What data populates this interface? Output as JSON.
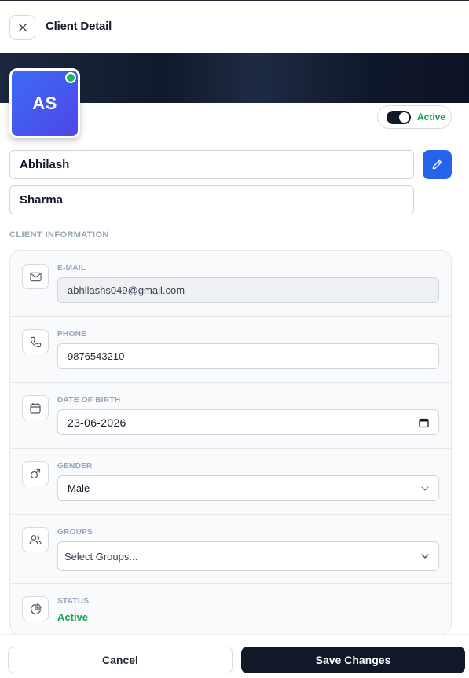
{
  "header": {
    "title": "Client Detail",
    "close_icon": "close-icon"
  },
  "profile": {
    "initials": "AS",
    "online": true,
    "status_toggle_label": "Active",
    "status_toggle_on": true,
    "first_name": "Abhilash",
    "last_name": "Sharma"
  },
  "section": {
    "title": "CLIENT INFORMATION"
  },
  "fields": {
    "email": {
      "label": "E-MAIL",
      "value": "abhilashs049@gmail.com",
      "icon": "mail-icon"
    },
    "phone": {
      "label": "PHONE",
      "value": "9876543210",
      "icon": "phone-icon"
    },
    "dob": {
      "label": "DATE OF BIRTH",
      "value": "23-06-2026",
      "icon": "calendar-icon"
    },
    "gender": {
      "label": "GENDER",
      "value": "Male",
      "icon": "gender-male-icon"
    },
    "groups": {
      "label": "GROUPS",
      "placeholder": "Select Groups...",
      "icon": "users-icon"
    },
    "status": {
      "label": "STATUS",
      "value": "Active",
      "icon": "pie-chart-icon"
    }
  },
  "footer": {
    "cancel_label": "Cancel",
    "save_label": "Save Changes"
  },
  "colors": {
    "accent_blue": "#2563eb",
    "active_green": "#16a34a",
    "dark": "#111827"
  }
}
